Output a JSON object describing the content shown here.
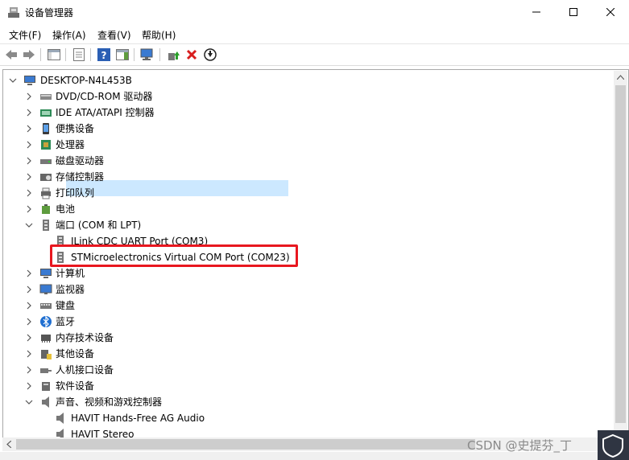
{
  "window": {
    "title": "设备管理器"
  },
  "menu": {
    "file": "文件(F)",
    "action": "操作(A)",
    "view": "查看(V)",
    "help": "帮助(H)"
  },
  "tree": {
    "root": "DESKTOP-N4L453B",
    "categories": [
      "DVD/CD-ROM 驱动器",
      "IDE ATA/ATAPI 控制器",
      "便携设备",
      "处理器",
      "磁盘驱动器",
      "存储控制器",
      "打印队列",
      "电池",
      "端口 (COM 和 LPT)",
      "计算机",
      "监视器",
      "键盘",
      "蓝牙",
      "内存技术设备",
      "其他设备",
      "人机接口设备",
      "软件设备",
      "声音、视频和游戏控制器"
    ],
    "ports_children": [
      "JLink CDC UART Port (COM3)",
      "STMicroelectronics Virtual COM Port (COM23)"
    ],
    "audio_children": [
      "HAVIT Hands-Free AG Audio",
      "HAVIT Stereo"
    ]
  },
  "watermark": "CSDN @史提芬_丁",
  "colors": {
    "selection": "#cce8ff",
    "highlight_border": "#e8171f"
  }
}
